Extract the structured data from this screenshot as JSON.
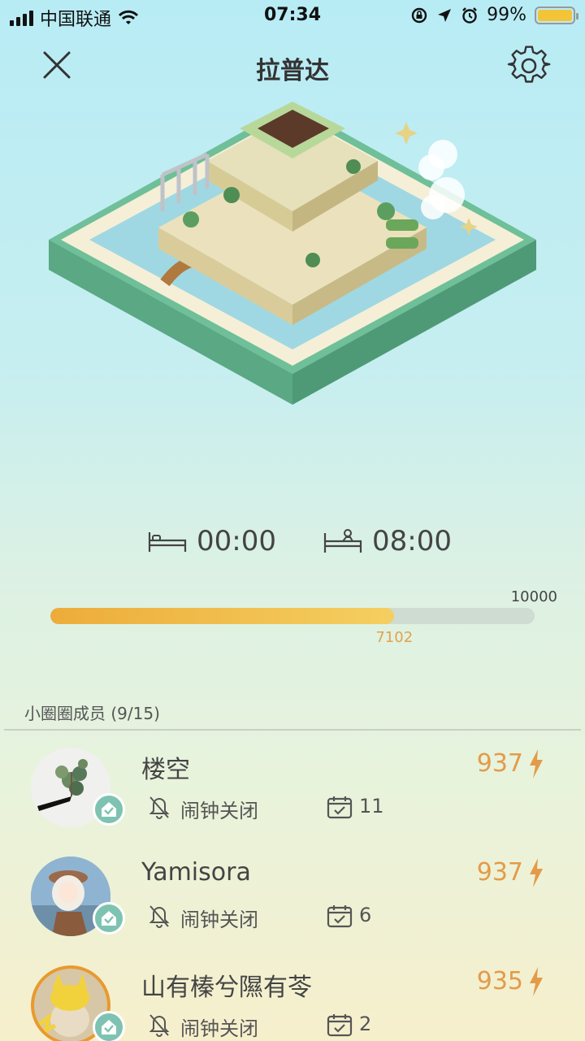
{
  "status_bar": {
    "carrier": "中国联通",
    "time": "07:34",
    "battery": "99%"
  },
  "header": {
    "title": "拉普达",
    "close_icon": "close-icon",
    "settings_icon": "gear-icon"
  },
  "sleep": {
    "bedtime": "00:00",
    "wake_time": "08:00"
  },
  "progress": {
    "goal": "10000",
    "current": "7102",
    "fraction": 0.7102
  },
  "members_section": {
    "title": "小圈圈成员 (9/15)"
  },
  "members": [
    {
      "name": "楼空",
      "score": "937",
      "alarm": "闹钟关闭",
      "days": "11"
    },
    {
      "name": "Yamisora",
      "score": "937",
      "alarm": "闹钟关闭",
      "days": "6"
    },
    {
      "name": "山有榛兮隰有苓",
      "score": "935",
      "alarm": "闹钟关闭",
      "days": "2"
    }
  ],
  "colors": {
    "accent": "#e39b4a",
    "progress_start": "#edac3a",
    "progress_end": "#f4cf60",
    "verified_badge": "#7ec3b1"
  }
}
